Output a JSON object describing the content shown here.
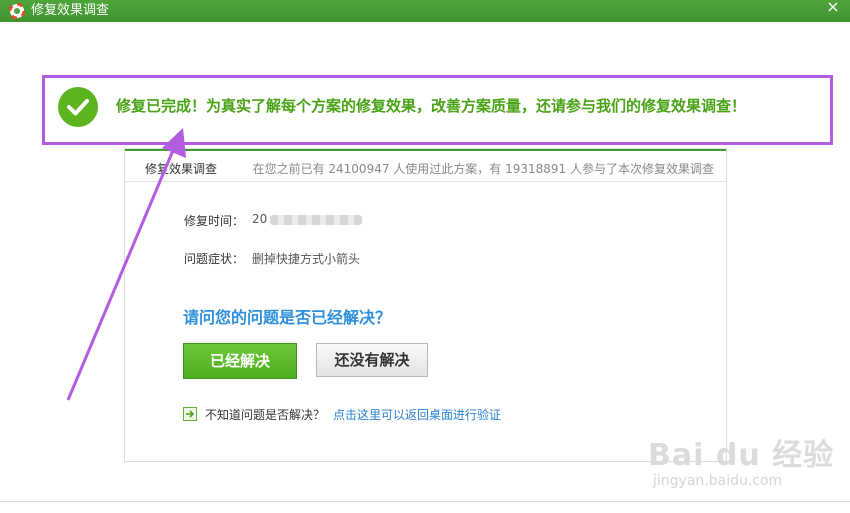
{
  "window": {
    "title": "修复效果调查",
    "close_glyph": "×"
  },
  "banner": {
    "message": "修复已完成！为真实了解每个方案的修复效果，改善方案质量，还请参与我们的修复效果调查！"
  },
  "card": {
    "title": "修复效果调查",
    "stats": "在您之前已有 24100947 人使用过此方案，有 19318891 人参与了本次修复效果调查",
    "repair_time_label": "修复时间：",
    "repair_time_value": "20",
    "symptom_label": "问题症状：",
    "symptom_value": "删掉快捷方式小箭头",
    "question": "请问您的问题是否已经解决？",
    "solved_button": "已经解决",
    "unsolved_button": "还没有解决",
    "unsure_text": "不知道问题是否解决？",
    "verify_link": "点击这里可以返回桌面进行验证"
  },
  "watermark": {
    "logo": "Bai du 经验",
    "url": "jingyan.baidu.com"
  },
  "colors": {
    "titlebar": "#4ea53b",
    "accent_green": "#5cb51e",
    "annotation_purple": "#b25ce0",
    "question_blue": "#2f8fdc",
    "link_blue": "#2a7fd4"
  },
  "icons": [
    "app-lifebuoy-icon",
    "close-icon",
    "check-icon",
    "arrow-right-icon"
  ]
}
